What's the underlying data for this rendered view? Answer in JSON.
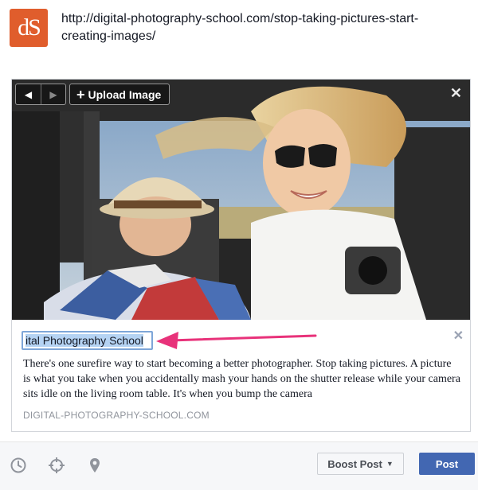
{
  "source": {
    "favicon_text": "dS",
    "favicon_color": "#e05d2c",
    "url": "http://digital-photography-school.com/stop-taking-pictures-start-creating-images/"
  },
  "photo_controls": {
    "prev_symbol": "◀",
    "next_symbol": "▶",
    "upload_label": "Upload Image",
    "upload_symbol": "+",
    "close_symbol": "✕"
  },
  "link_preview": {
    "title_value": "ital Photography School",
    "description": "There's one surefire way to start becoming a better photographer. Stop taking pictures. A picture is what you take when you accidentally mash your hands on the shutter release while your camera sits idle on the living room table. It's when you bump the camera",
    "domain": "DIGITAL-PHOTOGRAPHY-SCHOOL.COM",
    "close_symbol": "✕"
  },
  "annotation": {
    "arrow_color": "#e8327a"
  },
  "toolbar": {
    "icons": [
      "clock-icon",
      "crosshair-icon",
      "location-pin-icon"
    ],
    "boost_label": "Boost Post",
    "boost_caret": "▼",
    "post_label": "Post",
    "post_color": "#4267b2"
  }
}
